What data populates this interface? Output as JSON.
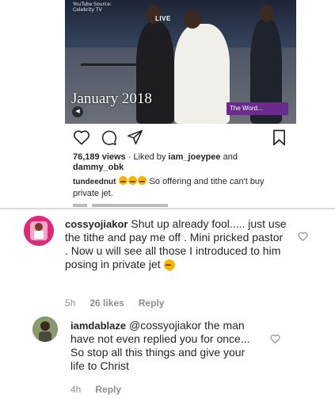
{
  "video": {
    "source_line1": "YouTube Source:",
    "source_line2": "Celebrity TV",
    "live_label": "LIVE",
    "date_overlay": "January 2018",
    "badge": "The Word..."
  },
  "post": {
    "views": "76,189 views",
    "liked_prefix": " · Liked by ",
    "liked_user1": "iam_joeypee",
    "liked_and": " and",
    "liked_user2": "dammy_obk",
    "caption_user": "tundeednut",
    "caption_text": " So offering and tithe can't buy private jet."
  },
  "comments": [
    {
      "username": "cossyojiakor",
      "text": " Shut up already fool..... just use the tithe and pay me off . Mini pricked pastor . Now u will see all those I introduced to him posing in private jet",
      "time": "5h",
      "likes": "26 likes",
      "reply": "Reply",
      "avatar_color": "#e0287a"
    },
    {
      "username": "iamdablaze",
      "mention": "@cossyojiakor",
      "text": " the man have not even replied you for once... So stop all this things and give your life to Christ",
      "time": "4h",
      "reply": "Reply",
      "avatar_color": "#6b7a55"
    }
  ],
  "icons": [
    "heart-icon",
    "comment-icon",
    "share-icon",
    "bookmark-icon",
    "sound-icon"
  ]
}
